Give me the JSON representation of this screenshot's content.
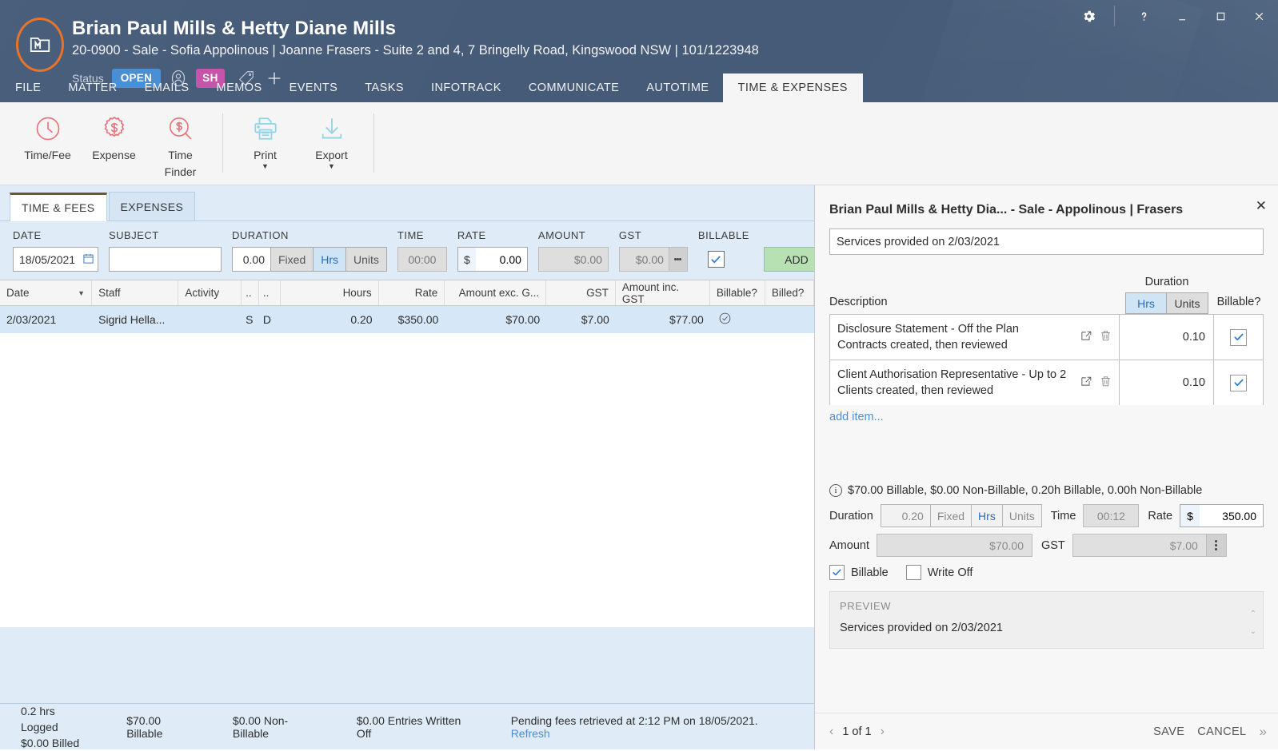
{
  "window": {
    "title": "Brian Paul Mills & Hetty Diane Mills",
    "subtitle": "20-0900 - Sale - Sofia Appolinous | Joanne Frasers - Suite 2 and 4, 7 Bringelly Road, Kingswood NSW | 101/1223948",
    "status_label": "Status",
    "status_value": "OPEN",
    "user_initials": "SH",
    "controls": {
      "settings": "gear-icon",
      "help": "?",
      "minimize": "minimize-icon",
      "maximize": "maximize-icon",
      "close": "close-icon"
    }
  },
  "nav": {
    "tabs": [
      {
        "label": "FILE",
        "active": false
      },
      {
        "label": "MATTER",
        "active": false
      },
      {
        "label": "EMAILS",
        "active": false
      },
      {
        "label": "MEMOS",
        "active": false
      },
      {
        "label": "EVENTS",
        "active": false
      },
      {
        "label": "TASKS",
        "active": false
      },
      {
        "label": "INFOTRACK",
        "active": false
      },
      {
        "label": "COMMUNICATE",
        "active": false
      },
      {
        "label": "AUTOTIME",
        "active": false
      },
      {
        "label": "TIME & EXPENSES",
        "active": true
      }
    ]
  },
  "ribbon": {
    "items": [
      {
        "label": "Time/Fee",
        "icon": "clock-icon",
        "caret": false
      },
      {
        "label": "Expense",
        "icon": "dollar-badge-icon",
        "caret": false
      },
      {
        "label": "Time\nFinder",
        "label1": "Time",
        "label2": "Finder",
        "icon": "dollar-search-icon",
        "caret": false
      },
      {
        "label": "Print",
        "icon": "printer-icon",
        "caret": true
      },
      {
        "label": "Export",
        "icon": "download-icon",
        "caret": true
      }
    ]
  },
  "subtabs": [
    {
      "label": "TIME & FEES",
      "active": true
    },
    {
      "label": "EXPENSES",
      "active": false
    }
  ],
  "entry_form": {
    "labels": {
      "date": "DATE",
      "subject": "SUBJECT",
      "duration": "DURATION",
      "time": "TIME",
      "rate": "RATE",
      "amount": "AMOUNT",
      "gst": "GST",
      "billable": "BILLABLE"
    },
    "date_value": "18/05/2021",
    "subject_value": "",
    "duration_value": "0.00",
    "duration_fixed": "Fixed",
    "duration_hrs": "Hrs",
    "duration_units": "Units",
    "time_value": "00:00",
    "rate_symbol": "$",
    "rate_value": "0.00",
    "amount_value": "$0.00",
    "gst_value": "$0.00",
    "billable_checked": true,
    "add_label": "ADD",
    "close_label": "✕"
  },
  "grid": {
    "columns": [
      "Date",
      "Staff",
      "Activity",
      "..",
      "..",
      "Hours",
      "Rate",
      "Amount exc. G...",
      "GST",
      "Amount inc. GST",
      "Billable?",
      "Billed?"
    ],
    "sort_column": "Date",
    "sort_direction": "desc",
    "rows": [
      {
        "date": "2/03/2021",
        "staff": "Sigrid Hella...",
        "activity": "",
        "col4": "S",
        "col5": "D",
        "hours": "0.20",
        "rate": "$350.00",
        "amount_exc": "$70.00",
        "gst": "$7.00",
        "amount_inc": "$77.00",
        "billable": "check-circle-icon",
        "billed": ""
      }
    ]
  },
  "statusbar": {
    "hrs_logged": "0.2 hrs Logged",
    "billed": "$0.00 Billed",
    "billable": "$70.00 Billable",
    "non_billable": "$0.00 Non-Billable",
    "written_off": "$0.00 Entries Written Off",
    "pending": "Pending fees retrieved at 2:12 PM on 18/05/2021.",
    "refresh": "Refresh"
  },
  "panel": {
    "title": "Brian Paul Mills & Hetty Dia... - Sale - Appolinous | Frasers",
    "close": "✕",
    "description_value": "Services provided on 2/03/2021",
    "items_header": {
      "description": "Description",
      "duration": "Duration",
      "hrs": "Hrs",
      "units": "Units",
      "billable": "Billable?"
    },
    "duration_mode": "Hrs",
    "items": [
      {
        "description": "Disclosure Statement - Off the Plan Contracts created, then reviewed",
        "duration": "0.10",
        "billable": true
      },
      {
        "description": "Client Authorisation Representative - Up to 2 Clients created, then reviewed",
        "duration": "0.10",
        "billable": true
      }
    ],
    "add_item": "add item...",
    "summary_line": "$70.00 Billable, $0.00 Non-Billable, 0.20h Billable, 0.00h Non-Billable",
    "fields": {
      "duration_label": "Duration",
      "duration_value": "0.20",
      "duration_fixed": "Fixed",
      "duration_hrs": "Hrs",
      "duration_units": "Units",
      "time_label": "Time",
      "time_value": "00:12",
      "rate_label": "Rate",
      "rate_symbol": "$",
      "rate_value": "350.00",
      "amount_label": "Amount",
      "amount_value": "$70.00",
      "gst_label": "GST",
      "gst_value": "$7.00"
    },
    "billable_label": "Billable",
    "billable_checked": true,
    "writeoff_label": "Write Off",
    "writeoff_checked": false,
    "preview_caption": "PREVIEW",
    "preview_text": "Services provided on 2/03/2021",
    "pager": "1 of 1",
    "save_label": "SAVE",
    "cancel_label": "CANCEL"
  },
  "colors": {
    "header_bg": "#455b78",
    "accent_orange": "#e8732a",
    "status_blue": "#4a8fd4",
    "user_chip": "#c555ab",
    "add_green": "#b7e1b2",
    "link_blue": "#4a8fd4",
    "ribbon_red": "#e8737b",
    "ribbon_cyan": "#8fd4e8"
  }
}
